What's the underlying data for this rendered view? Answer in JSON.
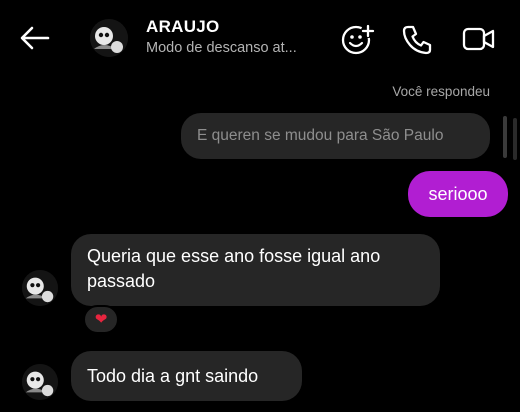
{
  "header": {
    "name": "ARAUJO",
    "status": "Modo de descanso at...",
    "icons": [
      "back-arrow-icon",
      "add-people-icon",
      "phone-icon",
      "video-camera-icon"
    ]
  },
  "thread": {
    "reply_label": "Você respondeu",
    "quoted_text": "E queren se mudou para São Paulo",
    "messages": [
      {
        "from": "me",
        "text": "seriooo"
      },
      {
        "from": "them",
        "text_line1": "Queria que esse ano fosse igual ano",
        "text_line2": "passado",
        "reaction": "❤"
      },
      {
        "from": "them",
        "text": "Todo dia a gnt saindo"
      }
    ]
  },
  "colors": {
    "background": "#000000",
    "outgoing_bubble": "#b11ed2",
    "incoming_bubble": "#262626",
    "reaction_heart": "#e8253f"
  }
}
